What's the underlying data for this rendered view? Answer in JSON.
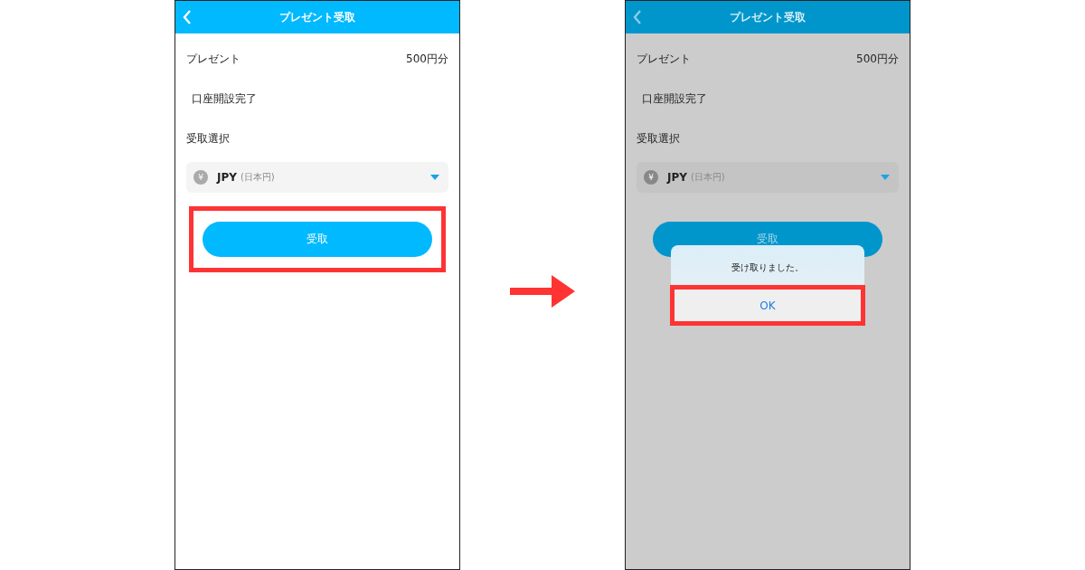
{
  "screens": [
    {
      "dimmed": false,
      "header": {
        "title": "プレゼント受取"
      },
      "present": {
        "label": "プレゼント",
        "value": "500円分"
      },
      "campaign": "口座開設完了",
      "section_label": "受取選択",
      "currency_select": {
        "symbol": "¥",
        "code": "JPY",
        "name": "(日本円)"
      },
      "receive_button": {
        "label": "受取",
        "highlighted": true
      }
    },
    {
      "dimmed": true,
      "header": {
        "title": "プレゼント受取"
      },
      "present": {
        "label": "プレゼント",
        "value": "500円分"
      },
      "campaign": "口座開設完了",
      "section_label": "受取選択",
      "currency_select": {
        "symbol": "¥",
        "code": "JPY",
        "name": "(日本円)"
      },
      "receive_button": {
        "label": "受取",
        "highlighted": false
      },
      "dialog": {
        "message": "受け取りました。",
        "ok_button": {
          "label": "OK",
          "highlighted": true
        }
      }
    }
  ]
}
